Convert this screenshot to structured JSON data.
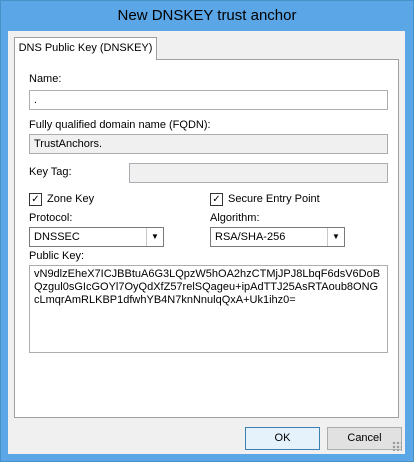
{
  "window": {
    "title": "New DNSKEY trust anchor"
  },
  "tabs": [
    {
      "label": "DNS Public Key (DNSKEY)"
    }
  ],
  "form": {
    "name_label": "Name:",
    "name_value": ".",
    "fqdn_label": "Fully qualified domain name (FQDN):",
    "fqdn_value": "TrustAnchors.",
    "keytag_label": "Key Tag:",
    "keytag_value": "",
    "zone_key": {
      "label": "Zone Key",
      "checked": true
    },
    "sep": {
      "label": "Secure Entry Point",
      "checked": true
    },
    "protocol_label": "Protocol:",
    "protocol_value": "DNSSEC",
    "algorithm_label": "Algorithm:",
    "algorithm_value": "RSA/SHA-256",
    "public_key_label": "Public Key:",
    "public_key_value": "vN9dlzEheX7ICJBBtuA6G3LQpzW5hOA2hzCTMjJPJ8LbqF6dsV6DoBQzgul0sGIcGOYl7OyQdXfZ57relSQageu+ipAdTTJ25AsRTAoub8ONGcLmqrAmRLKBP1dfwhYB4N7knNnulqQxA+Uk1ihz0="
  },
  "buttons": {
    "ok": "OK",
    "cancel": "Cancel"
  },
  "icons": {
    "check": "✓",
    "dropdown": "▼"
  }
}
